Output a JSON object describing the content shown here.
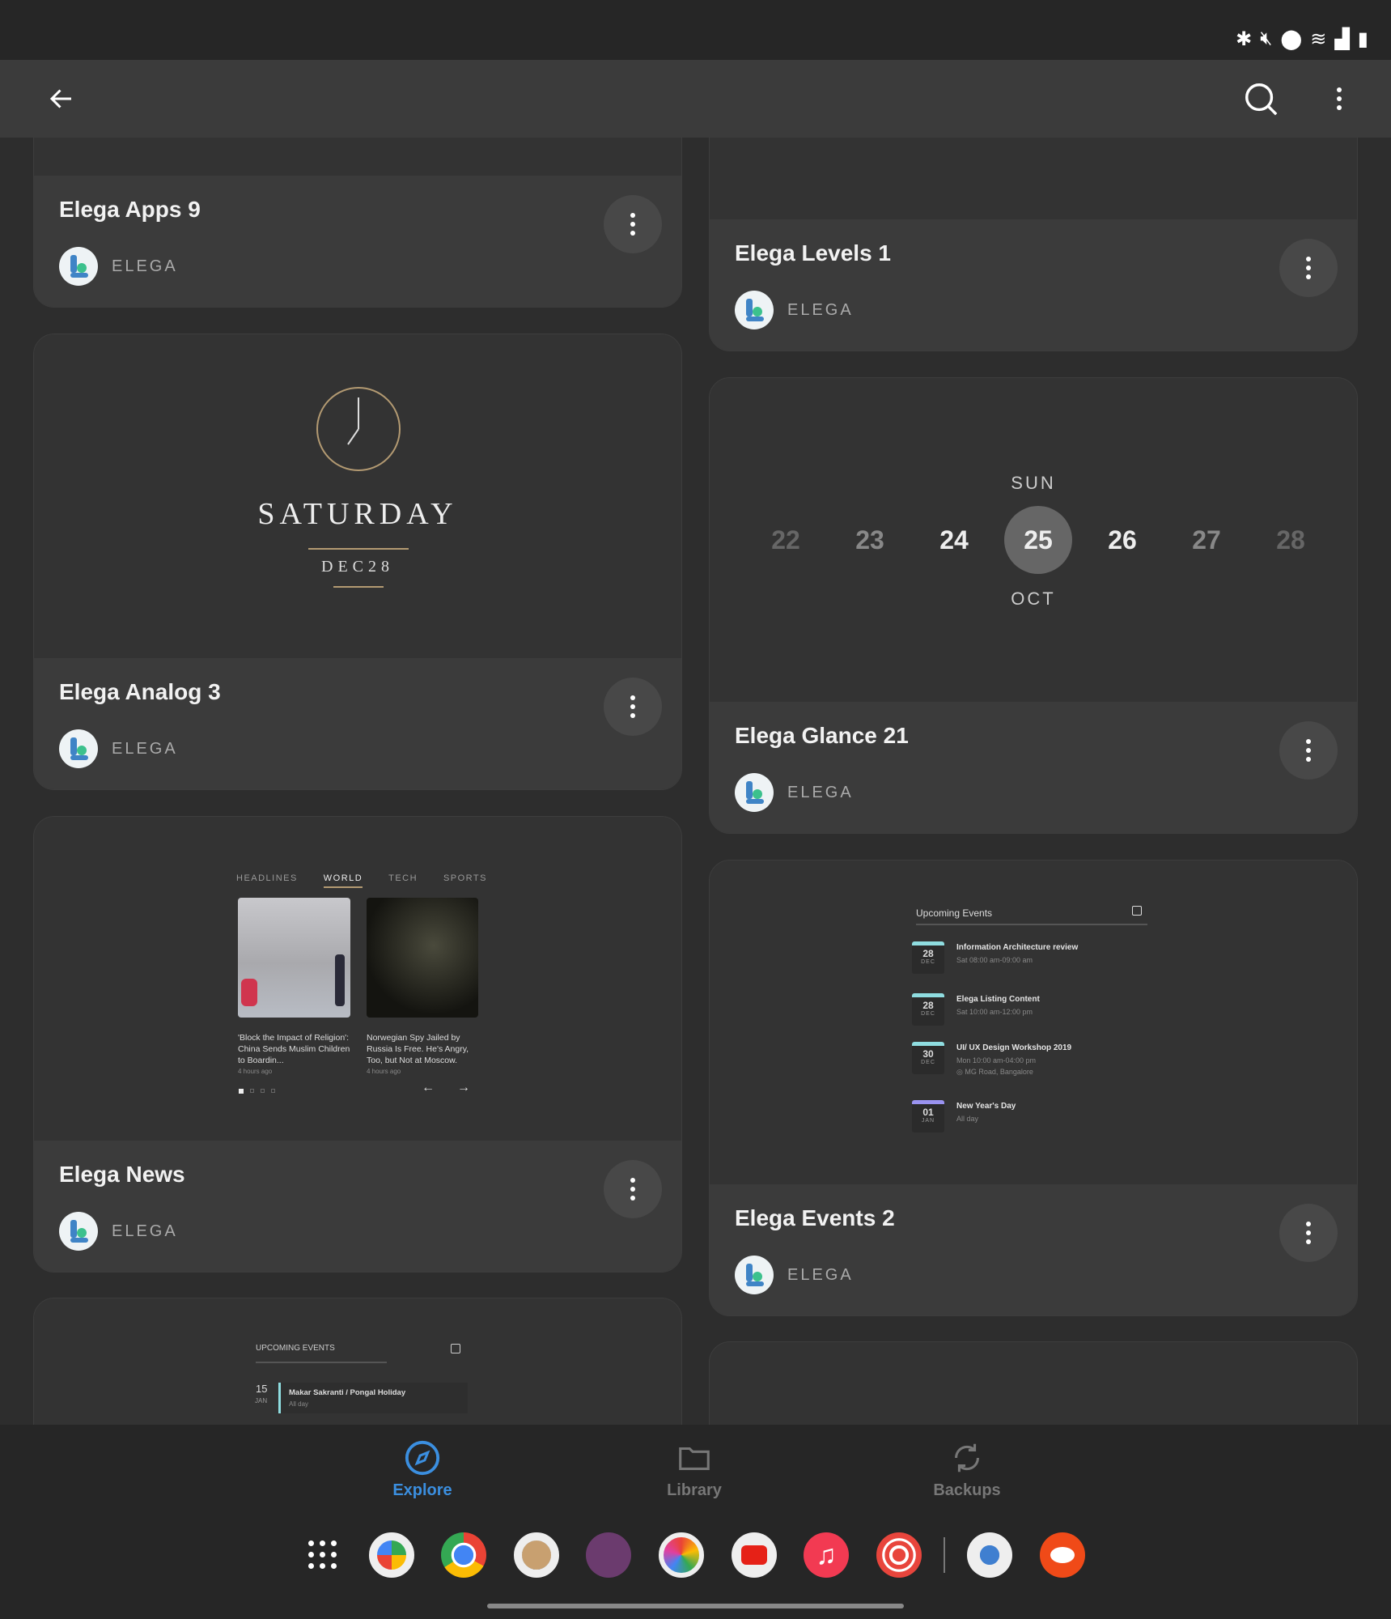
{
  "status_bar": {
    "icons": [
      "bluetooth-icon",
      "mute-icon",
      "location-icon",
      "wifi-icon",
      "signal-icon",
      "battery-icon"
    ]
  },
  "top_bar": {
    "back": "back-icon",
    "search": "search-icon",
    "more": "more-icon"
  },
  "cards": [
    {
      "title": "Elega Apps 9",
      "author": "ELEGA"
    },
    {
      "title": "Elega Levels 1",
      "author": "ELEGA"
    },
    {
      "title": "Elega Analog 3",
      "author": "ELEGA",
      "preview": {
        "day": "SATURDAY",
        "date": "DEC28"
      }
    },
    {
      "title": "Elega Glance 21",
      "author": "ELEGA",
      "preview": {
        "weekday": "SUN",
        "month": "OCT",
        "dates": [
          "22",
          "23",
          "24",
          "25",
          "26",
          "27",
          "28"
        ],
        "selected": "25"
      }
    },
    {
      "title": "Elega News",
      "author": "ELEGA",
      "preview": {
        "tabs": [
          "HEADLINES",
          "WORLD",
          "TECH",
          "SPORTS"
        ],
        "active_tab": "WORLD",
        "articles": [
          {
            "headline": "'Block the Impact of Religion': China Sends Muslim Children to Boardin...",
            "time": "4 hours ago"
          },
          {
            "headline": "Norwegian Spy Jailed by Russia Is Free. He's Angry, Too, but Not at Moscow.",
            "time": "4 hours ago"
          }
        ]
      }
    },
    {
      "title": "Elega Events 2",
      "author": "ELEGA",
      "preview": {
        "header": "Upcoming Events",
        "events": [
          {
            "day": "28",
            "month": "DEC",
            "title": "Information Architecture review",
            "time": "Sat 08:00 am-09:00 am",
            "color": "#8fdde0"
          },
          {
            "day": "28",
            "month": "DEC",
            "title": "Elega Listing Content",
            "time": "Sat 10:00 am-12:00 pm",
            "color": "#8fdde0"
          },
          {
            "day": "30",
            "month": "DEC",
            "title": "UI/ UX Design Workshop 2019",
            "time": "Mon 10:00 am-04:00 pm",
            "location": "MG Road, Bangalore",
            "color": "#8fdde0"
          },
          {
            "day": "01",
            "month": "JAN",
            "title": "New Year's Day",
            "time": "All day",
            "color": "#9a93f0"
          }
        ]
      }
    },
    {
      "preview": {
        "header": "UPCOMING EVENTS",
        "event": {
          "day": "15",
          "month": "JAN",
          "title": "Makar Sakranti / Pongal Holiday",
          "time": "All day"
        }
      }
    }
  ],
  "bottom_nav": [
    {
      "label": "Explore",
      "icon": "compass-icon",
      "active": true
    },
    {
      "label": "Library",
      "icon": "folder-icon"
    },
    {
      "label": "Backups",
      "icon": "sync-icon"
    }
  ],
  "dock": [
    "app-drawer",
    "play-store",
    "chrome",
    "file-manager",
    "notes",
    "photos",
    "youtube",
    "music",
    "pocket-casts",
    "settings",
    "reddit"
  ],
  "colors": {
    "accent": "#3b8fe0",
    "card": "#3b3b3b",
    "background": "#2d2d2d"
  }
}
